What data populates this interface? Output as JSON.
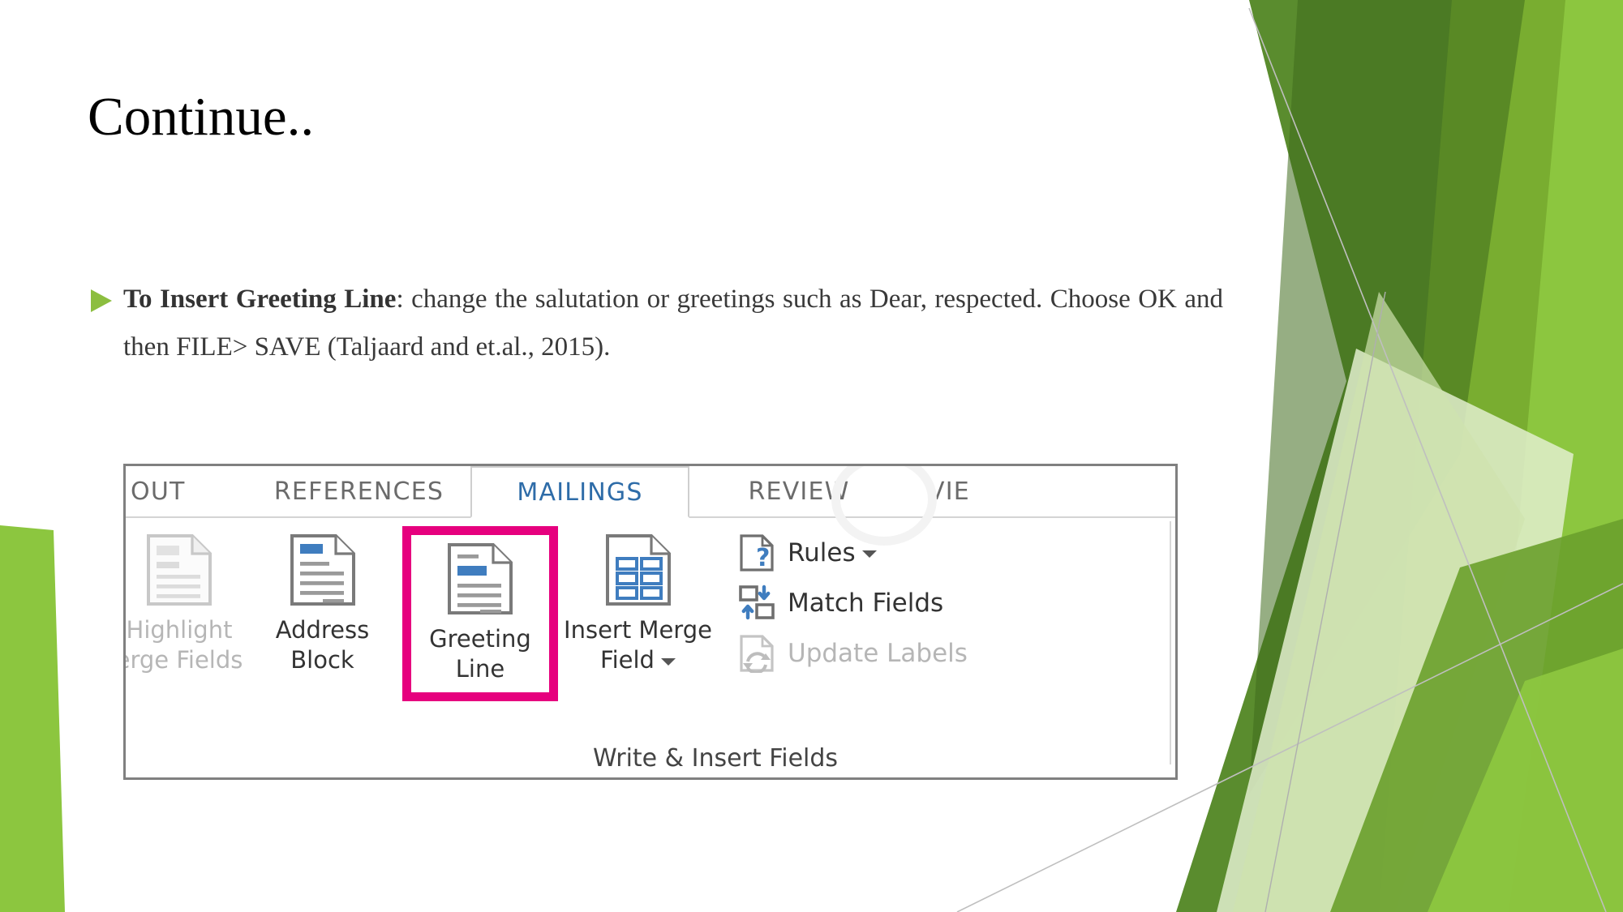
{
  "slide": {
    "title": "Continue..",
    "bullet": {
      "marker_icon": "triangle-bullet-icon",
      "lead": "To Insert Greeting Line",
      "rest": ": change the salutation or greetings such as Dear, respected. Choose OK and then FILE> SAVE (Taljaard and et.al., 2015)."
    }
  },
  "ribbon": {
    "tabs": [
      {
        "id": "layout",
        "label": "OUT",
        "active": false
      },
      {
        "id": "references",
        "label": "REFERENCES",
        "active": false
      },
      {
        "id": "mailings",
        "label": "MAILINGS",
        "active": true
      },
      {
        "id": "review",
        "label": "REVIEW",
        "active": false
      },
      {
        "id": "view",
        "label": "VIE",
        "active": false
      }
    ],
    "buttons": [
      {
        "id": "highlight-merge-fields",
        "line1": "Highlight",
        "line2": "erge Fields",
        "icon": "document-lines-icon",
        "disabled": true,
        "highlighted": false
      },
      {
        "id": "address-block",
        "line1": "Address",
        "line2": "Block",
        "icon": "document-address-icon",
        "disabled": false,
        "highlighted": false
      },
      {
        "id": "greeting-line",
        "line1": "Greeting",
        "line2": "Line",
        "icon": "document-greeting-icon",
        "disabled": false,
        "highlighted": true
      },
      {
        "id": "insert-merge-field",
        "line1": "Insert Merge",
        "line2": "Field",
        "icon": "document-grid-icon",
        "disabled": false,
        "highlighted": false,
        "has_dropdown": true
      }
    ],
    "commands": [
      {
        "id": "rules",
        "label": "Rules",
        "icon": "document-question-icon",
        "disabled": false,
        "has_dropdown": true
      },
      {
        "id": "match-fields",
        "label": "Match Fields",
        "icon": "match-fields-icon",
        "disabled": false,
        "has_dropdown": false
      },
      {
        "id": "update-labels",
        "label": "Update Labels",
        "icon": "refresh-document-icon",
        "disabled": true,
        "has_dropdown": false
      }
    ],
    "group_label": "Write & Insert Fields"
  },
  "theme": {
    "bullet_green": "#8CBE3F",
    "highlight_magenta": "#E6007E",
    "active_tab_blue": "#2E6CA8",
    "icon_blue": "#3F7DBF",
    "disabled_gray": "#B6B6B6",
    "green_dark": "#4E7B28",
    "green_mid": "#6AA02C",
    "green_light": "#8CC63F",
    "green_pale": "#DCE9C4"
  }
}
